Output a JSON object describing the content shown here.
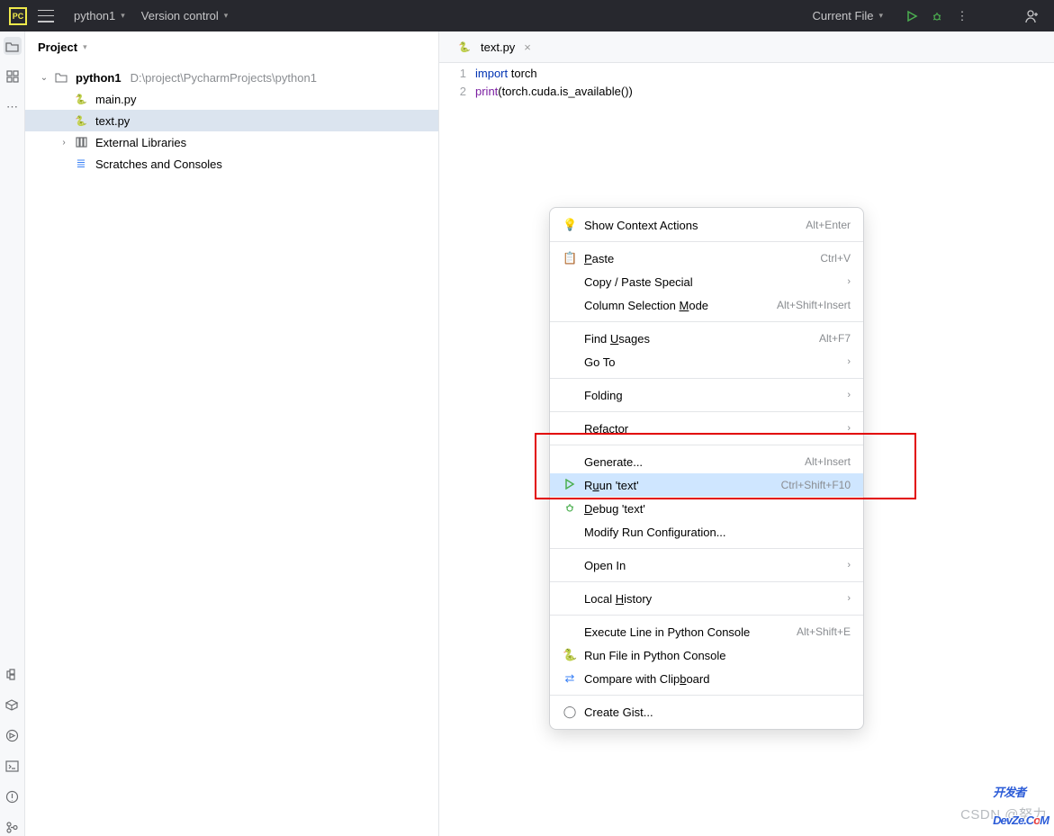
{
  "topbar": {
    "project": "python1",
    "vcs": "Version control",
    "runconfig": "Current File"
  },
  "sidebar": {
    "title": "Project",
    "root": {
      "name": "python1",
      "path": "D:\\project\\PycharmProjects\\python1"
    },
    "files": [
      "main.py",
      "text.py"
    ],
    "ext": "External Libraries",
    "scratch": "Scratches and Consoles"
  },
  "editor": {
    "tab": "text.py",
    "lines": [
      {
        "n": "1",
        "pre": "import",
        "post": " torch"
      },
      {
        "n": "2",
        "pre": "print",
        "post": "(torch.cuda.is_available())"
      }
    ]
  },
  "menu": {
    "showContext": "Show Context Actions",
    "showContext_sc": "Alt+Enter",
    "paste": "aste",
    "paste_sc": "Ctrl+V",
    "copyPaste": "Copy / Paste Special",
    "columnSel": "Column Selection ",
    "columnSel2": "ode",
    "columnSel_sc": "Alt+Shift+Insert",
    "findU": "Find ",
    "findU2": "sages",
    "findU_sc": "Alt+F7",
    "goto": "Go To",
    "folding": "Folding",
    "refactor": "efactor",
    "generate": "Generate...",
    "generate_sc": "Alt+Insert",
    "run": "un 'text'",
    "run_sc": "Ctrl+Shift+F10",
    "debug": "ebug 'text'",
    "modify": "Modify Run Configuration...",
    "openin": "Open In",
    "localh": "Local ",
    "localh2": "istory",
    "execline": "Execute Line in Python Console",
    "execline_sc": "Alt+Shift+E",
    "runfile": "Run File in Python Console",
    "compare": "Compare with Clip",
    "compare2": "oard",
    "gist": "Create Gist..."
  },
  "watermark": "CSDN @努力",
  "brand": {
    "a": "开发者",
    "b": "DevZe.C",
    "c": "o",
    "d": "M"
  }
}
